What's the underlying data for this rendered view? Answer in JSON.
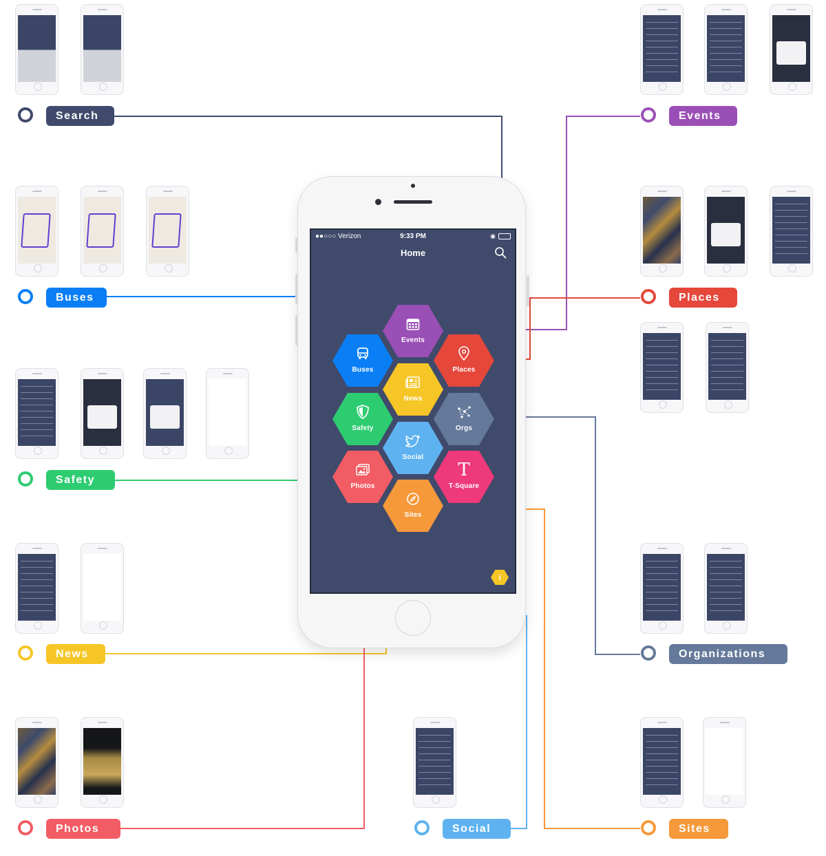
{
  "phone": {
    "status": {
      "carrier": "●●○○○ Verizon",
      "time": "9:33 PM"
    },
    "title": "Home"
  },
  "tiles": [
    {
      "key": "events",
      "label": "Events",
      "icon": "calendar-icon",
      "color": "#9a4fb6"
    },
    {
      "key": "buses",
      "label": "Buses",
      "icon": "bus-icon",
      "color": "#0a7ff5"
    },
    {
      "key": "places",
      "label": "Places",
      "icon": "location-pin-icon",
      "color": "#e5473b"
    },
    {
      "key": "news",
      "label": "News",
      "icon": "newspaper-icon",
      "color": "#f6c627"
    },
    {
      "key": "safety",
      "label": "Safety",
      "icon": "shield-icon",
      "color": "#2ecc71"
    },
    {
      "key": "orgs",
      "label": "Orgs",
      "icon": "network-icon",
      "color": "#65799b"
    },
    {
      "key": "social",
      "label": "Social",
      "icon": "twitter-bird-icon",
      "color": "#5fb2f0"
    },
    {
      "key": "photos",
      "label": "Photos",
      "icon": "photos-icon",
      "color": "#f25c64"
    },
    {
      "key": "tsquare",
      "label": "T-Square",
      "glyph": "T",
      "icon": "t-square-icon",
      "color": "#ee3a7a"
    },
    {
      "key": "sites",
      "label": "Sites",
      "icon": "compass-icon",
      "color": "#f5993a"
    }
  ],
  "sections": [
    {
      "key": "search",
      "label": "Search",
      "color": "#3f4a6c"
    },
    {
      "key": "events",
      "label": "Events",
      "color": "#9a4fb6"
    },
    {
      "key": "buses",
      "label": "Buses",
      "color": "#0a7ff5"
    },
    {
      "key": "places",
      "label": "Places",
      "color": "#e5473b"
    },
    {
      "key": "safety",
      "label": "Safety",
      "color": "#2ecc71"
    },
    {
      "key": "news",
      "label": "News",
      "color": "#f6c627"
    },
    {
      "key": "organizations",
      "label": "Organizations",
      "color": "#65799b"
    },
    {
      "key": "photos",
      "label": "Photos",
      "color": "#f25c64"
    },
    {
      "key": "social",
      "label": "Social",
      "color": "#5fb2f0"
    },
    {
      "key": "sites",
      "label": "Sites",
      "color": "#f5993a"
    }
  ],
  "info_badge": {
    "glyph": "i",
    "color": "#f6c627"
  }
}
